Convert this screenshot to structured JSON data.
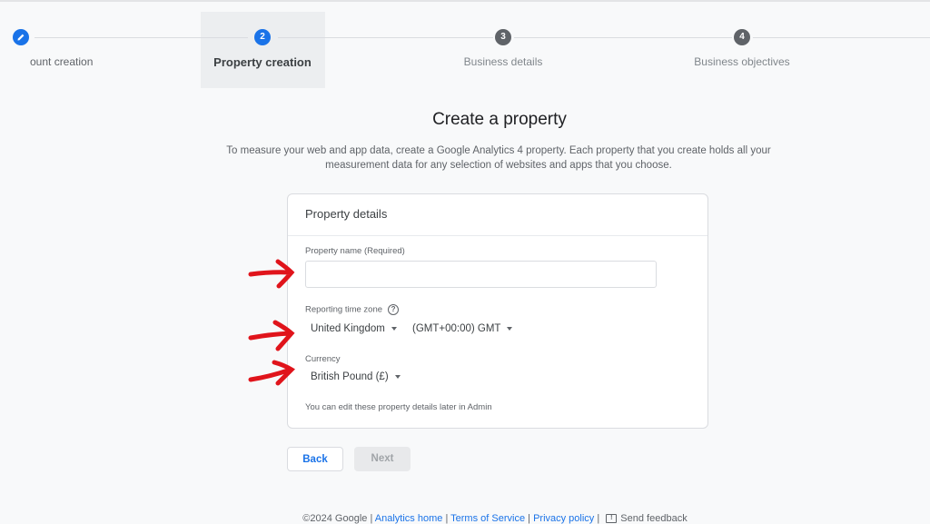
{
  "stepper": {
    "steps": [
      {
        "number": "",
        "icon": "pencil-icon",
        "label": "Account creation",
        "visible_label": "ount creation",
        "state": "completed"
      },
      {
        "number": "2",
        "label": "Property creation",
        "state": "active"
      },
      {
        "number": "3",
        "label": "Business details",
        "state": "pending"
      },
      {
        "number": "4",
        "label": "Business objectives",
        "state": "pending"
      }
    ]
  },
  "page": {
    "title": "Create a property",
    "intro_line1": "To measure your web and app data, create a Google Analytics 4 property. Each property that you create holds all your",
    "intro_line2": "measurement data for any selection of websites and apps that you choose."
  },
  "card": {
    "header": "Property details",
    "property_name": {
      "label": "Property name (Required)",
      "value": "",
      "placeholder": ""
    },
    "time_zone": {
      "label": "Reporting time zone",
      "help_icon": "help-circle-icon",
      "country": "United Kingdom",
      "zone": "(GMT+00:00) GMT"
    },
    "currency": {
      "label": "Currency",
      "value": "British Pound (£)"
    },
    "note": "You can edit these property details later in Admin"
  },
  "buttons": {
    "back": "Back",
    "next": "Next"
  },
  "footer": {
    "copyright": "©2024 Google",
    "links": [
      "Analytics home",
      "Terms of Service",
      "Privacy policy"
    ],
    "feedback": "Send feedback",
    "separator": "|"
  },
  "annotations": {
    "arrow_color": "#e0141b",
    "arrow_count": 3
  },
  "colors": {
    "accent": "#1a73e8",
    "background": "#f8f9fa",
    "inactive_step": "#5f6368"
  }
}
